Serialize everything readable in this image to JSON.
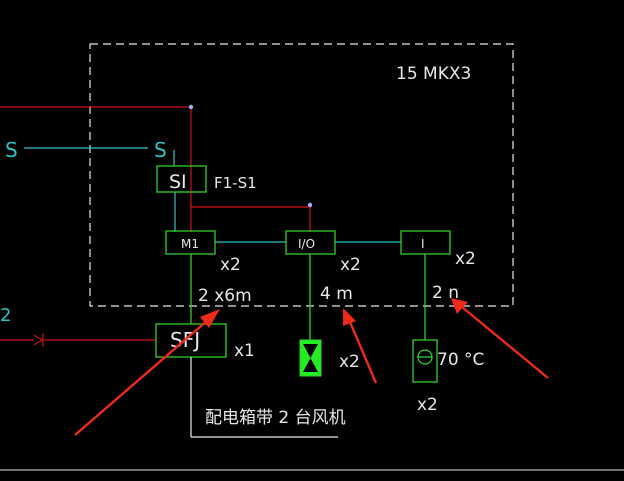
{
  "colors": {
    "background": "#000000",
    "cyan": "#2ec4c4",
    "red": "#d01010",
    "green": "#2fd02f",
    "white": "#e8e8e8",
    "arrow": "#ee2a1a",
    "valve": "#22ee22",
    "marker": "#9ab0ff"
  },
  "diagram": {
    "panel_label": "15 MKX3",
    "left_edge_label": "2",
    "signal_left_label": "S",
    "signal_right_label": "S",
    "si_box_label": "SI",
    "f1_label": "F1-S1",
    "modules": [
      {
        "label": "M1",
        "multiplier": "x2"
      },
      {
        "label": "I/O",
        "multiplier": "x2"
      },
      {
        "label": "I",
        "multiplier": "x2"
      }
    ],
    "cable_labels": [
      "2 x6m",
      "4 m",
      "2 n"
    ],
    "sfj_label": "SFJ",
    "sfj_multiplier": "x1",
    "valve_multiplier": "x2",
    "sensor_label": "70 °C",
    "sensor_multiplier": "x2",
    "bottom_note": "配电箱带 2 台风机"
  }
}
